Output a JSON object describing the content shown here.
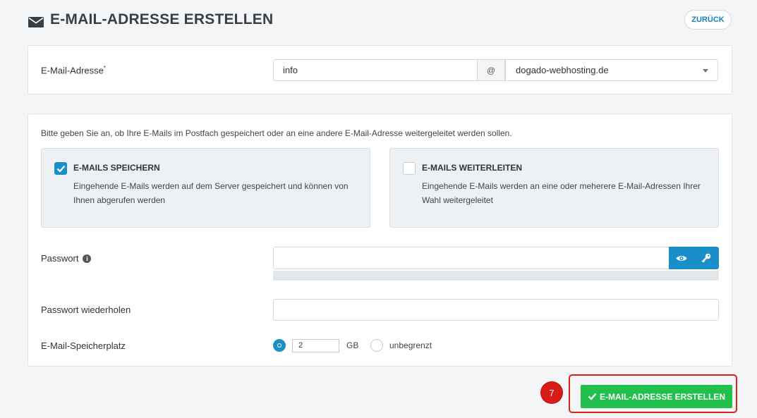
{
  "header": {
    "title": "E-MAIL-ADRESSE ERSTELLEN",
    "title_icon": "envelope-icon",
    "back_label": "ZURÜCK"
  },
  "address": {
    "label": "E-Mail-Adresse",
    "required_mark": "*",
    "local_part": "info",
    "at_sign": "@",
    "domain": "dogado-webhosting.de"
  },
  "delivery": {
    "intro": "Bitte geben Sie an, ob Ihre E-Mails im Postfach gespeichert oder an eine andere E-Mail-Adresse weitergeleitet werden sollen.",
    "store": {
      "title": "E-MAILS SPEICHERN",
      "description": "Eingehende E-Mails werden auf dem Server gespeichert und können von Ihnen abgerufen werden",
      "checked": true
    },
    "forward": {
      "title": "E-MAILS WEITERLEITEN",
      "description": "Eingehende E-Mails werden an eine oder meherere E-Mail-Adressen Ihrer Wahl weitergeleitet",
      "checked": false
    },
    "password_label": "Passwort",
    "password_value": "",
    "password_repeat_label": "Passwort wiederholen",
    "password_repeat_value": "",
    "storage_label": "E-Mail-Speicherplatz",
    "storage_value": "2",
    "storage_unit": "GB",
    "unlimited_label": "unbegrenzt"
  },
  "footer": {
    "step_number": "7",
    "submit_label": "E-MAIL-ADRESSE ERSTELLEN",
    "highlight_color": "#e0201b",
    "submit_color": "#21bf4b"
  },
  "colors": {
    "accent": "#1a8ec8",
    "background": "#f4f5f7"
  }
}
